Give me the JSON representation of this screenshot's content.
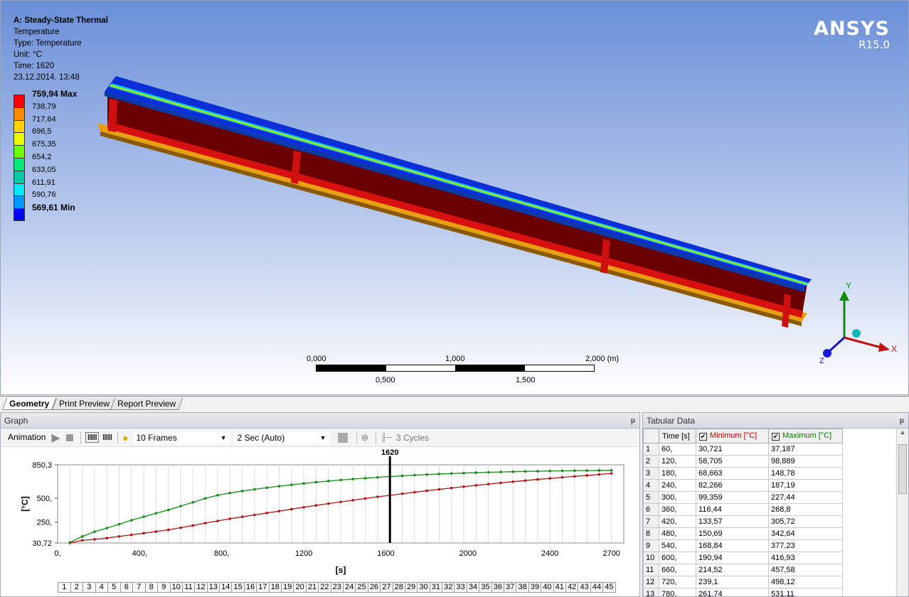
{
  "viewport": {
    "info": {
      "title": "A: Steady-State Thermal",
      "quantity": "Temperature",
      "type": "Type: Temperature",
      "unit": "Unit: °C",
      "time": "Time: 1620",
      "date": "23.12.2014. 13:48"
    },
    "legend": [
      {
        "label": "759,94 Max",
        "color": "#ff0000",
        "bold": true
      },
      {
        "label": "738,79",
        "color": "#ff8a00"
      },
      {
        "label": "717,64",
        "color": "#ffd200"
      },
      {
        "label": "696,5",
        "color": "#e8ff00"
      },
      {
        "label": "675,35",
        "color": "#6cff00"
      },
      {
        "label": "654,2",
        "color": "#00e87a"
      },
      {
        "label": "633,05",
        "color": "#00c8a8"
      },
      {
        "label": "611,91",
        "color": "#00e8ff"
      },
      {
        "label": "590,76",
        "color": "#0096ff"
      },
      {
        "label": "569,61 Min",
        "color": "#0000ff",
        "bold": true
      }
    ],
    "brand": {
      "logo": "ANSYS",
      "version": "R15.0"
    },
    "scale": {
      "top": [
        "0,000",
        "1,000",
        "2,000 (m)"
      ],
      "bottom": [
        "0,500",
        "1,500"
      ]
    },
    "triad": {
      "x": "X",
      "y": "Y",
      "z": "Z"
    }
  },
  "tabs": [
    {
      "label": "Geometry",
      "active": true
    },
    {
      "label": "Print Preview"
    },
    {
      "label": "Report Preview"
    }
  ],
  "graph": {
    "title": "Graph",
    "pin": "ᵽ",
    "toolbar": {
      "animation": "Animation",
      "frames": "10 Frames",
      "duration": "2 Sec (Auto)",
      "cycles": "3 Cycles"
    },
    "frames": [
      "1",
      "2",
      "3",
      "4",
      "5",
      "6",
      "7",
      "8",
      "9",
      "10",
      "11",
      "12",
      "13",
      "14",
      "15",
      "16",
      "17",
      "18",
      "19",
      "20",
      "21",
      "22",
      "23",
      "24",
      "25",
      "26",
      "27",
      "28",
      "29",
      "30",
      "31",
      "32",
      "33",
      "34",
      "35",
      "36",
      "37",
      "38",
      "39",
      "40",
      "41",
      "42",
      "43",
      "44",
      "45"
    ]
  },
  "tabular": {
    "title": "Tabular Data",
    "pin": "ᵽ",
    "headers": [
      "Time [s]",
      "Minimum [°C]",
      "Maximum [°C]"
    ],
    "min_color": "#c00000",
    "max_color": "#008000",
    "rows": [
      [
        "1",
        "60,",
        "30,721",
        "37,187"
      ],
      [
        "2",
        "120,",
        "58,705",
        "98,889"
      ],
      [
        "3",
        "180,",
        "68,663",
        "148,78"
      ],
      [
        "4",
        "240,",
        "82,266",
        "187,19"
      ],
      [
        "5",
        "300,",
        "99,359",
        "227,44"
      ],
      [
        "6",
        "360,",
        "116,44",
        "268,8"
      ],
      [
        "7",
        "420,",
        "133,57",
        "305,72"
      ],
      [
        "8",
        "480,",
        "150,69",
        "342,64"
      ],
      [
        "9",
        "540,",
        "168,84",
        "377,23"
      ],
      [
        "10",
        "600,",
        "190,94",
        "416,93"
      ],
      [
        "11",
        "660,",
        "214,52",
        "457,58"
      ],
      [
        "12",
        "720,",
        "239,1",
        "498,12"
      ],
      [
        "13",
        "780,",
        "261,74",
        "531,11"
      ]
    ]
  },
  "chart_data": {
    "type": "line",
    "xlabel": "[s]",
    "ylabel": "[°C]",
    "xlim": [
      0,
      2760
    ],
    "ylim": [
      30.72,
      850.3
    ],
    "xticks": [
      "0,",
      "400,",
      "800,",
      "1200",
      "1600",
      "2000",
      "2400",
      "2700"
    ],
    "xtick_values": [
      0,
      400,
      800,
      1200,
      1600,
      2000,
      2400,
      2700
    ],
    "yticks": [
      "30,72",
      "250,",
      "500,",
      "850,3"
    ],
    "ytick_values": [
      30.72,
      250,
      500,
      850.3
    ],
    "marker": {
      "x": 1620,
      "label": "1620"
    },
    "series": [
      {
        "name": "Minimum [°C]",
        "color": "#b01010",
        "x": [
          60,
          120,
          180,
          240,
          300,
          360,
          420,
          480,
          540,
          600,
          660,
          720,
          780,
          840,
          900,
          960,
          1020,
          1080,
          1140,
          1200,
          1260,
          1320,
          1380,
          1440,
          1500,
          1560,
          1620,
          1680,
          1740,
          1800,
          1860,
          1920,
          1980,
          2040,
          2100,
          2160,
          2220,
          2280,
          2340,
          2400,
          2460,
          2520,
          2580,
          2640,
          2700
        ],
        "y": [
          30.721,
          58.705,
          68.663,
          82.266,
          99.359,
          116.44,
          133.57,
          150.69,
          168.84,
          190.94,
          214.52,
          239.1,
          261.74,
          285,
          305,
          325,
          345,
          365,
          385,
          405,
          425,
          443,
          461,
          479,
          497,
          515,
          530,
          547,
          563,
          578,
          593,
          607,
          621,
          635,
          648,
          661,
          673,
          685,
          697,
          708,
          719,
          729,
          739,
          749,
          759.94
        ]
      },
      {
        "name": "Maximum [°C]",
        "color": "#138a13",
        "x": [
          60,
          120,
          180,
          240,
          300,
          360,
          420,
          480,
          540,
          600,
          660,
          720,
          780,
          840,
          900,
          960,
          1020,
          1080,
          1140,
          1200,
          1260,
          1320,
          1380,
          1440,
          1500,
          1560,
          1620,
          1680,
          1740,
          1800,
          1860,
          1920,
          1980,
          2040,
          2100,
          2160,
          2220,
          2280,
          2340,
          2400,
          2460,
          2520,
          2580,
          2640,
          2700
        ],
        "y": [
          37.187,
          98.889,
          148.78,
          187.19,
          227.44,
          268.8,
          305.72,
          342.64,
          377.23,
          416.93,
          457.58,
          498.12,
          531.11,
          555,
          575,
          593,
          610,
          626,
          641,
          655,
          668,
          680,
          691,
          701,
          710,
          719,
          727,
          735,
          742,
          748,
          754,
          759,
          764,
          768,
          772,
          775,
          778,
          781,
          783,
          785,
          787,
          789,
          790,
          791,
          792
        ]
      }
    ]
  }
}
